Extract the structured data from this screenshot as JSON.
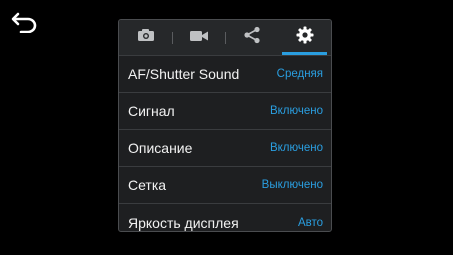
{
  "nav": {
    "back_icon": "back-arrow-icon"
  },
  "tabs": [
    {
      "icon": "camera-icon",
      "active": false
    },
    {
      "icon": "video-camera-icon",
      "active": false
    },
    {
      "icon": "share-icon",
      "active": false
    },
    {
      "icon": "gear-icon",
      "active": true
    }
  ],
  "settings": [
    {
      "label": "AF/Shutter Sound",
      "value": "Средняя"
    },
    {
      "label": "Сигнал",
      "value": "Включено"
    },
    {
      "label": "Описание",
      "value": "Включено"
    },
    {
      "label": "Сетка",
      "value": "Выключено"
    },
    {
      "label": "Яркость дисплея",
      "value": "Авто"
    }
  ],
  "colors": {
    "accent": "#2a9ee0",
    "background": "#000000",
    "panel": "#1e1f21"
  }
}
